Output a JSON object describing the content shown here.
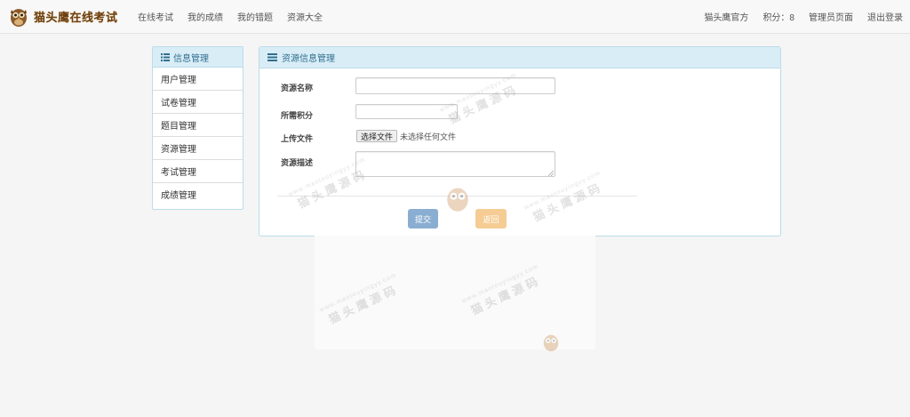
{
  "topbar": {
    "brand_text": "猫头鹰在线考试",
    "nav_left": [
      "在线考试",
      "我的成绩",
      "我的错题",
      "资源大全"
    ],
    "nav_right": [
      "猫头鹰官方",
      "积分：8",
      "管理员页面",
      "退出登录"
    ]
  },
  "sidebar": {
    "header": "信息管理",
    "items": [
      "用户管理",
      "试卷管理",
      "题目管理",
      "资源管理",
      "考试管理",
      "成绩管理"
    ]
  },
  "panel": {
    "header": "资源信息管理",
    "fields": {
      "name_label": "资源名称",
      "name_value": "",
      "points_label": "所需积分",
      "points_value": "",
      "upload_label": "上传文件",
      "file_button": "选择文件",
      "file_status": "未选择任何文件",
      "desc_label": "资源描述",
      "desc_value": ""
    },
    "buttons": {
      "submit": "提交",
      "back": "返回"
    }
  },
  "watermark": {
    "url": "www.maotouyingyy.com",
    "text": "猫头鹰源码"
  },
  "colors": {
    "panel_header_bg": "#d9edf7",
    "panel_header_text": "#31708f",
    "submit_button": "#8aaed1",
    "back_button": "#f5cc93",
    "brand": "#6b3e12"
  },
  "icons": {
    "brand": "owl-logo-icon",
    "sidebar_header": "list-icon",
    "panel_header": "menu-lines-icon"
  }
}
